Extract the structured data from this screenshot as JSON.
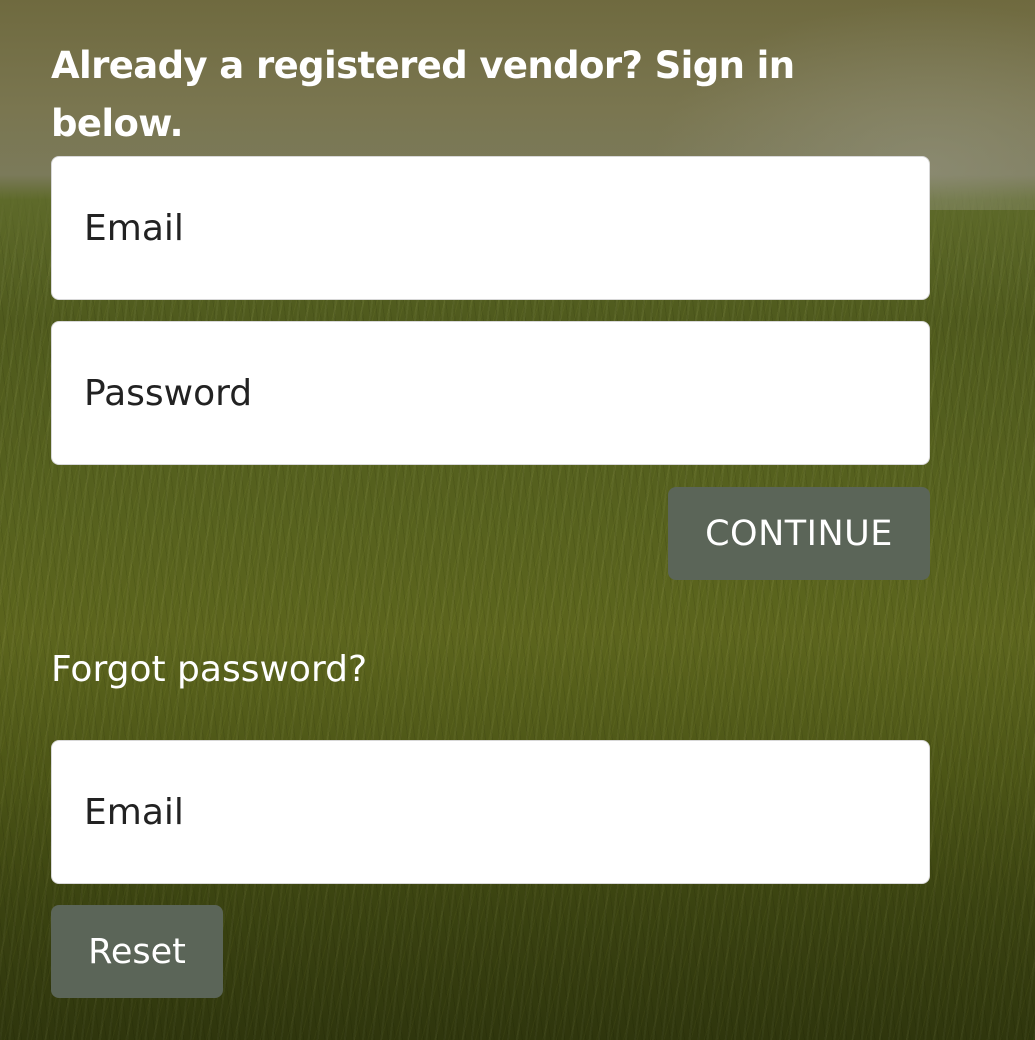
{
  "signin": {
    "heading": "Already a registered vendor? Sign in below.",
    "email_placeholder": "Email",
    "password_placeholder": "Password",
    "continue_label": "CONTINUE"
  },
  "reset": {
    "heading": "Forgot password?",
    "email_placeholder": "Email",
    "reset_label": "Reset"
  },
  "colors": {
    "button_bg": "#5b6558",
    "button_text": "#ffffff",
    "heading_text": "#ffffff",
    "field_bg": "#ffffff"
  },
  "background": {
    "image": "grass-field-photo"
  }
}
